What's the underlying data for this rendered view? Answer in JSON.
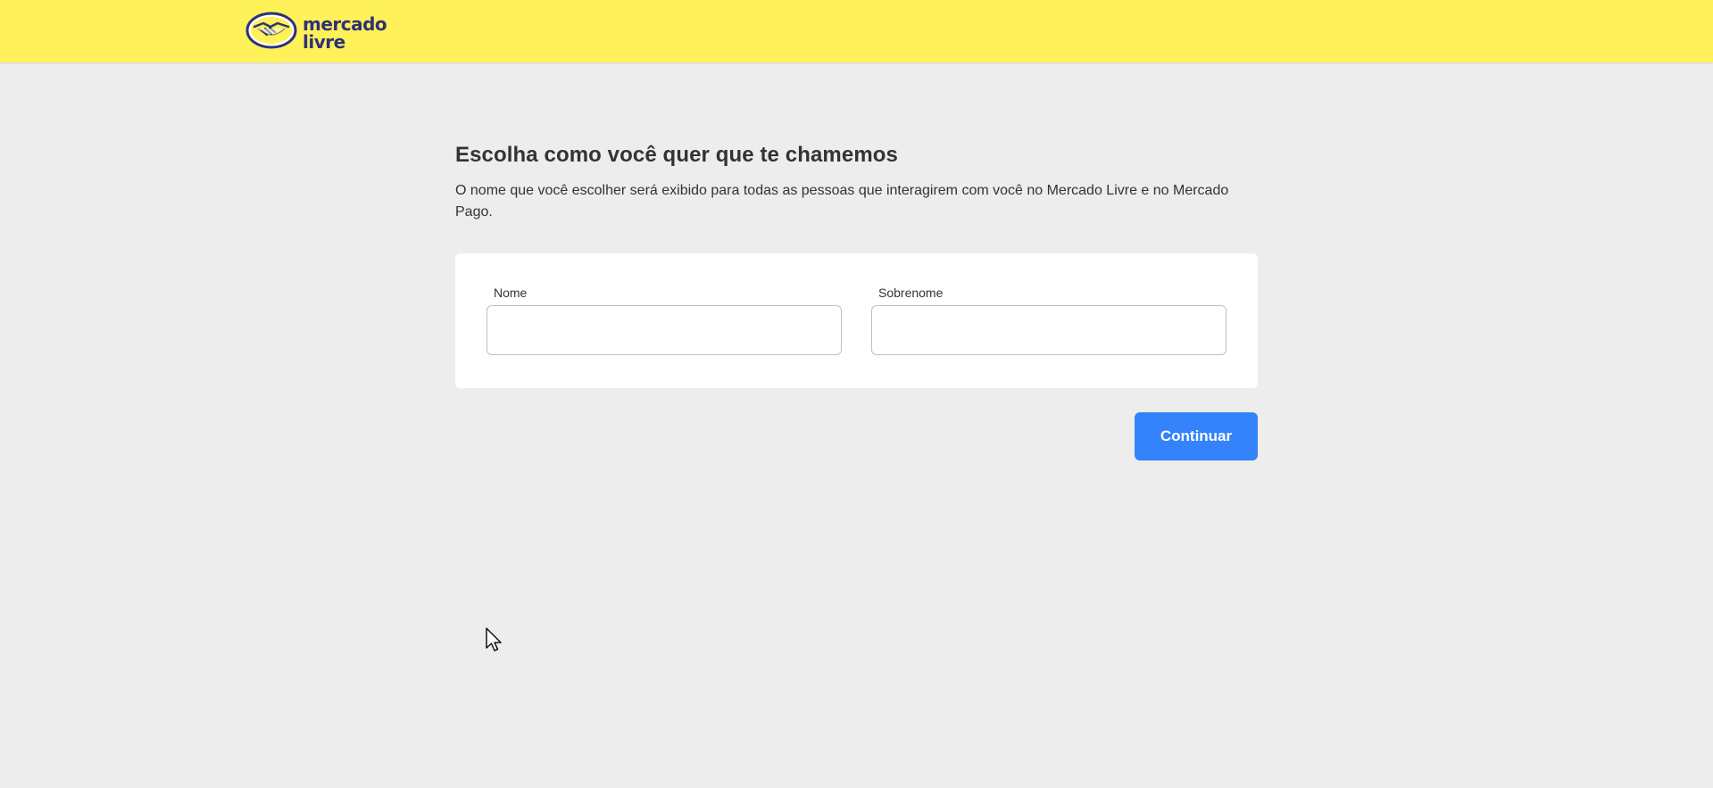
{
  "header": {
    "logo_line1": "mercado",
    "logo_line2": "livre",
    "background": "#fff159"
  },
  "main": {
    "title": "Escolha como você quer que te chamemos",
    "description": "O nome que você escolher será exibido para todas as pessoas que interagirem com você no Mercado Livre e no Mercado Pago.",
    "form": {
      "first_name_label": "Nome",
      "first_name_value": "",
      "last_name_label": "Sobrenome",
      "last_name_value": ""
    },
    "continue_label": "Continuar"
  },
  "colors": {
    "accent": "#3483fa",
    "page_bg": "#ededed",
    "logo_text": "#2d3277"
  },
  "icons": {
    "logo": "handshake-icon",
    "cursor": "mouse-pointer-icon"
  }
}
